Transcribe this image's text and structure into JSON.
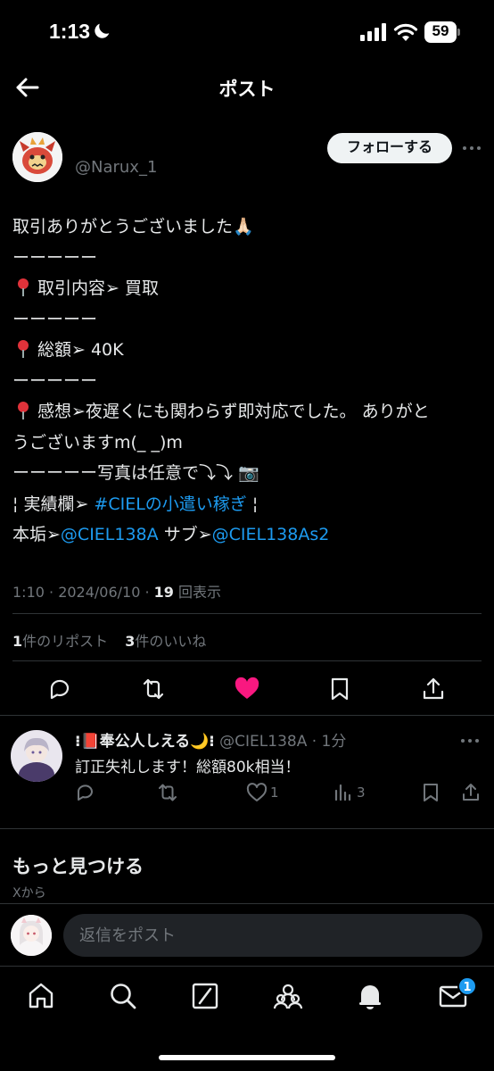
{
  "status_bar": {
    "time": "1:13",
    "battery": "59"
  },
  "header": {
    "title": "ポスト"
  },
  "post": {
    "username": "@Narux_1",
    "follow_label": "フォローする",
    "lines": {
      "l1": "取引ありがとうございました🙏🏻",
      "l2": "ーーーーー",
      "l3": "取引内容➢ 買取",
      "l4": "ーーーーー",
      "l5": "総額➢ 40K",
      "l6": "ーーーーー",
      "l7": "感想➢夜遅くにも関わらず即対応でした。 ありがと",
      "l8": "うございますm(_ _)m",
      "l9": "ーーーーー写真は任意で⤵︎⤵︎ 📷",
      "l10_pre": "¦ 実績欄➢ ",
      "l10_link": "#CIELの小遣い稼ぎ",
      "l10_post": " ¦",
      "l11_pre": "本垢➢",
      "l11_link1": "@CIEL138A",
      "l11_mid": " サブ➢",
      "l11_link2": "@CIEL138As2"
    },
    "timestamp": "1:10 · 2024/06/10 · ",
    "views_count": "19",
    "views_label": " 回表示",
    "reposts_count": "1",
    "reposts_label": "件のリポスト",
    "likes_count": "3",
    "likes_label": "件のいいね",
    "liked": true,
    "colors": {
      "like": "#f91880",
      "link": "#1d9bf0"
    }
  },
  "reply": {
    "name": "⁝📕奉公人しえる🌙⁝",
    "handle": "@CIEL138A · 1分",
    "text": "訂正失礼します！総額80k相当！",
    "likes": "1",
    "views": "3"
  },
  "discover": {
    "title": "もっと見つける",
    "subtitle": "Xから"
  },
  "composer": {
    "placeholder": "返信をポスト"
  },
  "tabbar": {
    "messages_badge": "1"
  }
}
